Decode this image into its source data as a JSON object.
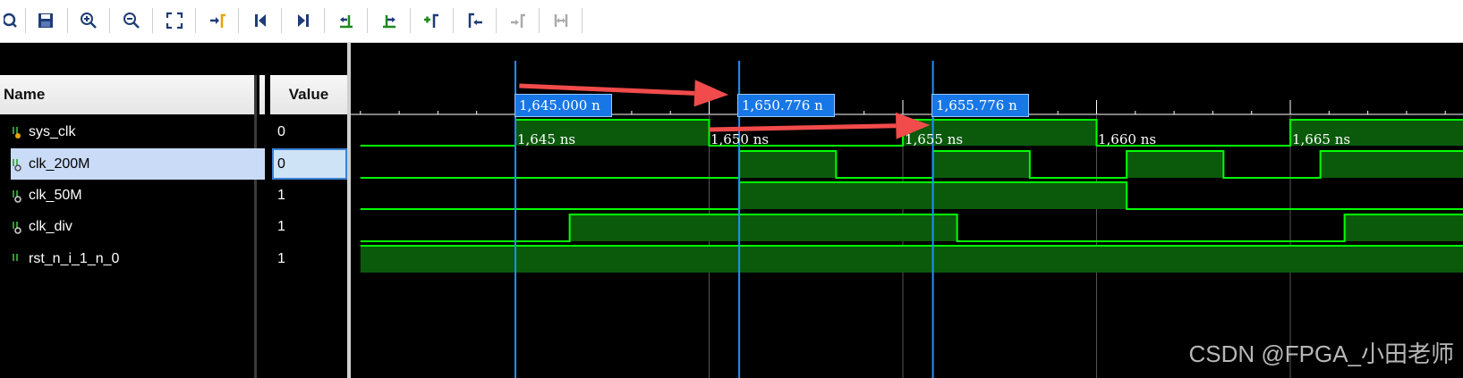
{
  "toolbar": {
    "buttons": [
      "search-icon",
      "save-icon",
      "zoom-in-icon",
      "zoom-out-icon",
      "zoom-fit-icon",
      "go-to-cursor-icon",
      "go-to-start-icon",
      "go-to-end-icon",
      "previous-transition-icon",
      "next-transition-icon",
      "add-marker-icon",
      "previous-marker-icon",
      "next-marker-icon",
      "swap-cursor-icon"
    ]
  },
  "signals_panel": {
    "name_header": "Name",
    "value_header": "Value",
    "signals": [
      {
        "name": "sys_clk",
        "value": "0"
      },
      {
        "name": "clk_200M",
        "value": "0"
      },
      {
        "name": "clk_50M",
        "value": "1"
      },
      {
        "name": "clk_div",
        "value": "1"
      },
      {
        "name": "rst_n_i_1_n_0",
        "value": "1"
      }
    ],
    "selected_signal": "clk_200M"
  },
  "waveform": {
    "time_unit": "ns",
    "tick_labels": [
      "1,645 ns",
      "1,650 ns",
      "1,655 ns",
      "1,660 ns",
      "1,665 ns"
    ],
    "tick_values": [
      1645,
      1650,
      1655,
      1660,
      1665
    ],
    "markers": [
      {
        "label": "1,645.000 n",
        "time": 1645.0
      },
      {
        "label": "1,650.776 n",
        "time": 1650.776
      },
      {
        "label": "1,655.776 n",
        "time": 1655.776
      }
    ],
    "annotations": [
      {
        "type": "arrow",
        "from_time": 1645.1,
        "to_time": 1650.5,
        "row": "above"
      },
      {
        "type": "arrow",
        "from_time": 1650.0,
        "to_time": 1655.7,
        "row": "sys_clk"
      }
    ],
    "wave_color": "#00ff00",
    "wave_fill": "#0b5a0b",
    "marker_color": "#1e90ff",
    "arrow_color": "#f24b4b"
  },
  "watermark": "CSDN @FPGA_小田老师"
}
